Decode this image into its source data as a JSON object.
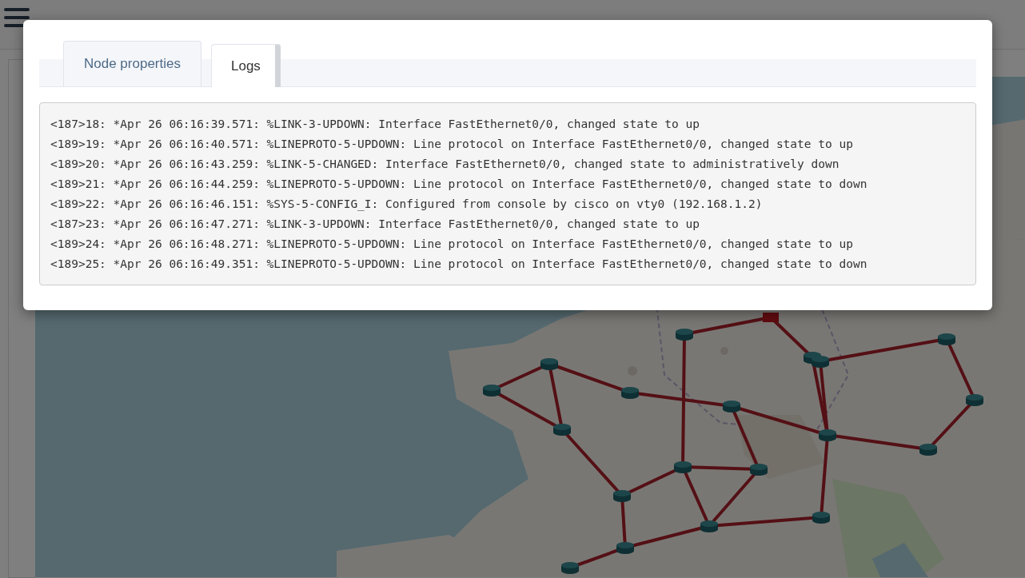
{
  "tabs": [
    {
      "label": "Node properties",
      "selected": false
    },
    {
      "label": "Logs",
      "selected": true
    }
  ],
  "logs": [
    "<187>18: *Apr 26 06:16:39.571: %LINK-3-UPDOWN: Interface FastEthernet0/0, changed state to up",
    "<189>19: *Apr 26 06:16:40.571: %LINEPROTO-5-UPDOWN: Line protocol on Interface FastEthernet0/0, changed state to up",
    "<189>20: *Apr 26 06:16:43.259: %LINK-5-CHANGED: Interface FastEthernet0/0, changed state to administratively down",
    "<189>21: *Apr 26 06:16:44.259: %LINEPROTO-5-UPDOWN: Line protocol on Interface FastEthernet0/0, changed state to down",
    "<189>22: *Apr 26 06:16:46.151: %SYS-5-CONFIG_I: Configured from console by cisco on vty0 (192.168.1.2)",
    "<187>23: *Apr 26 06:16:47.271: %LINK-3-UPDOWN: Interface FastEthernet0/0, changed state to up",
    "<189>24: *Apr 26 06:16:48.271: %LINEPROTO-5-UPDOWN: Line protocol on Interface FastEthernet0/0, changed state to up",
    "<189>25: *Apr 26 06:16:49.351: %LINEPROTO-5-UPDOWN: Line protocol on Interface FastEthernet0/0, changed state to down"
  ]
}
